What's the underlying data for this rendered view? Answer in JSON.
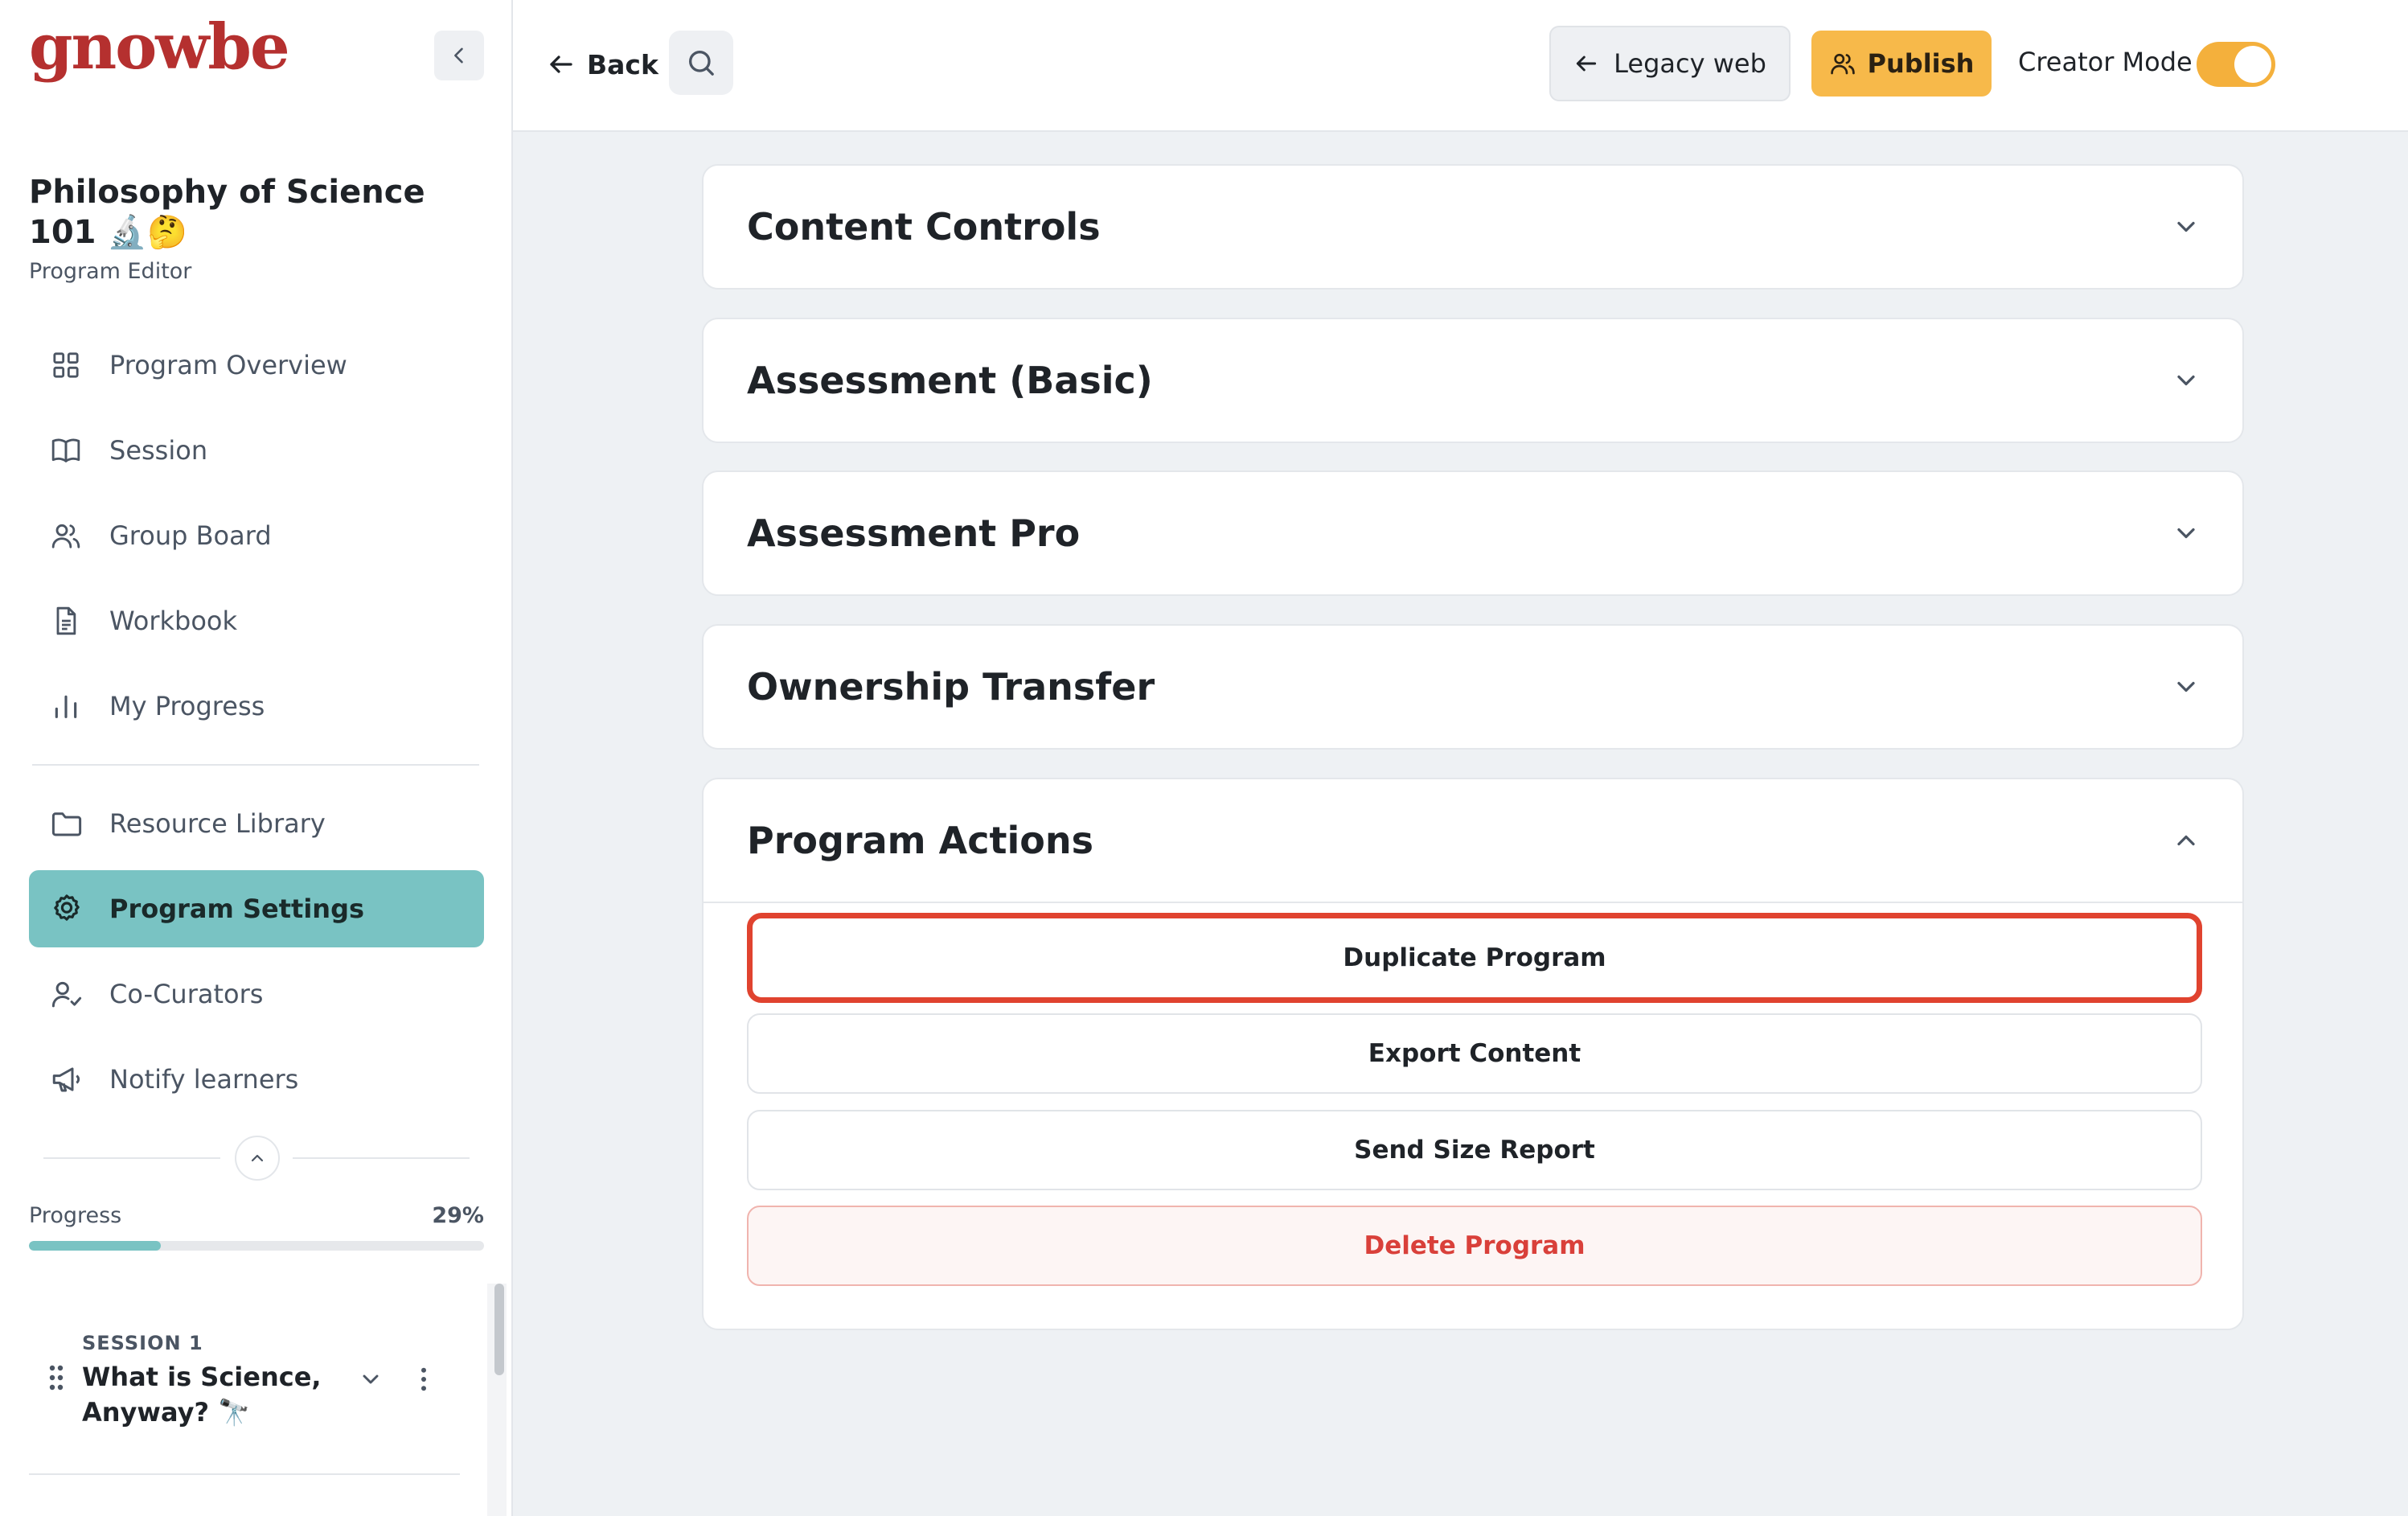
{
  "sidebar": {
    "logo": "gnowbe",
    "program_title": "Philosophy of Science 101 🔬🤔",
    "program_subtitle": "Program Editor",
    "nav_primary": [
      {
        "label": "Program Overview",
        "icon": "grid-icon"
      },
      {
        "label": "Session",
        "icon": "book-icon"
      },
      {
        "label": "Group Board",
        "icon": "users-icon"
      },
      {
        "label": "Workbook",
        "icon": "document-icon"
      },
      {
        "label": "My Progress",
        "icon": "bar-chart-icon"
      }
    ],
    "nav_secondary": [
      {
        "label": "Resource Library",
        "icon": "folder-icon"
      },
      {
        "label": "Program Settings",
        "icon": "gear-icon",
        "active": true
      },
      {
        "label": "Co-Curators",
        "icon": "user-check-icon"
      },
      {
        "label": "Notify learners",
        "icon": "megaphone-icon"
      }
    ],
    "progress": {
      "label": "Progress",
      "value_text": "29%",
      "value": 0.29
    },
    "session": {
      "kicker": "SESSION 1",
      "title": "What is Science, Anyway? 🔭"
    }
  },
  "topbar": {
    "back_label": "Back",
    "legacy_label": "Legacy web",
    "publish_label": "Publish",
    "creator_mode_label": "Creator Mode",
    "creator_mode_on": true
  },
  "main": {
    "sections": [
      {
        "title": "Content Controls",
        "expanded": false
      },
      {
        "title": "Assessment (Basic)",
        "expanded": false
      },
      {
        "title": "Assessment Pro",
        "expanded": false
      },
      {
        "title": "Ownership Transfer",
        "expanded": false
      },
      {
        "title": "Program Actions",
        "expanded": true
      }
    ],
    "actions": [
      {
        "label": "Duplicate Program",
        "highlighted": true
      },
      {
        "label": "Export Content"
      },
      {
        "label": "Send Size Report"
      },
      {
        "label": "Delete Program",
        "danger": true
      }
    ]
  },
  "colors": {
    "brand": "#b5302f",
    "active_nav": "#79c3c3",
    "publish": "#f7b94a",
    "toggle": "#f4b03c",
    "highlight": "#e0432f",
    "danger_text": "#d9403a"
  }
}
